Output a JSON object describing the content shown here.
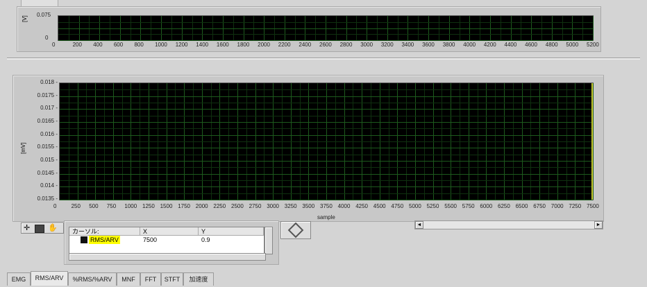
{
  "top_graph": {
    "y_label": "[V]",
    "y_ticks": [
      "0.075",
      "0"
    ],
    "x_ticks": [
      "0",
      "200",
      "400",
      "600",
      "800",
      "1000",
      "1200",
      "1400",
      "1600",
      "1800",
      "2000",
      "2200",
      "2400",
      "2600",
      "2800",
      "3000",
      "3200",
      "3400",
      "3600",
      "3800",
      "4000",
      "4200",
      "4400",
      "4600",
      "4800",
      "5000",
      "5200"
    ],
    "plot_color": "#000000",
    "grid_color": "#1d5a1d"
  },
  "main_graph": {
    "y_label": "[mV]",
    "x_label": "sample",
    "y_ticks": [
      "0.018",
      "0.0175",
      "0.017",
      "0.0165",
      "0.016",
      "0.0155",
      "0.015",
      "0.0145",
      "0.014",
      "0.0135"
    ],
    "x_ticks": [
      "0",
      "250",
      "500",
      "750",
      "1000",
      "1250",
      "1500",
      "1750",
      "2000",
      "2250",
      "2500",
      "2750",
      "3000",
      "3250",
      "3500",
      "3750",
      "4000",
      "4250",
      "4500",
      "4750",
      "5000",
      "5250",
      "5500",
      "5750",
      "6000",
      "6250",
      "6500",
      "6750",
      "7000",
      "7250",
      "7500"
    ]
  },
  "cursor_table": {
    "headers": [
      "カーソル:",
      "X",
      "Y"
    ],
    "row": {
      "name": "RMS/ARV",
      "x": "7500",
      "y": "0.9"
    },
    "highlight_color": "#ffff00"
  },
  "tools": {
    "zoom_icon": "zoom-icon",
    "pan_icon": "pan-hand-icon",
    "crosshair_icon": "crosshair-icon",
    "cursor_move_icon": "cursor-move-icon"
  },
  "tabs": [
    {
      "label": "EMG",
      "active": false
    },
    {
      "label": "RMS/ARV",
      "active": true
    },
    {
      "label": "%RMS/%ARV",
      "active": false
    },
    {
      "label": "MNF",
      "active": false
    },
    {
      "label": "FFT",
      "active": false
    },
    {
      "label": "STFT",
      "active": false
    },
    {
      "label": "加速度",
      "active": false
    }
  ]
}
